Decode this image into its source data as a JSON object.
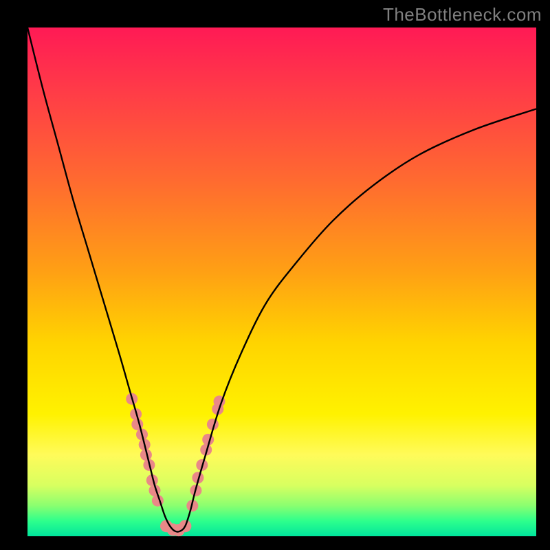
{
  "watermark": {
    "text": "TheBottleneck.com"
  },
  "chart_data": {
    "type": "line",
    "title": "",
    "xlabel": "",
    "ylabel": "",
    "xlim": [
      0,
      100
    ],
    "ylim": [
      0,
      100
    ],
    "grid": false,
    "legend": false,
    "series": [
      {
        "name": "bottleneck-curve",
        "x": [
          0,
          3,
          6,
          9,
          12,
          15,
          18,
          20,
          22,
          24,
          25,
          26,
          27,
          28,
          29,
          30,
          31,
          32,
          33,
          35,
          38,
          42,
          47,
          53,
          60,
          68,
          77,
          88,
          100
        ],
        "y": [
          100,
          88,
          77,
          66,
          56,
          46,
          36,
          29,
          22,
          14,
          10,
          7,
          4,
          2,
          1,
          1,
          2,
          5,
          9,
          16,
          26,
          36,
          46,
          54,
          62,
          69,
          75,
          80,
          84
        ]
      }
    ],
    "markers": [
      {
        "group": "left-branch",
        "points": [
          {
            "x": 20.5,
            "y": 27
          },
          {
            "x": 21.3,
            "y": 24
          },
          {
            "x": 21.6,
            "y": 22
          },
          {
            "x": 22.5,
            "y": 20
          },
          {
            "x": 23.0,
            "y": 18
          },
          {
            "x": 23.3,
            "y": 16
          },
          {
            "x": 23.9,
            "y": 14
          },
          {
            "x": 24.5,
            "y": 11
          },
          {
            "x": 25.0,
            "y": 9
          },
          {
            "x": 25.6,
            "y": 7
          }
        ]
      },
      {
        "group": "bottom",
        "points": [
          {
            "x": 27.3,
            "y": 2
          },
          {
            "x": 28.6,
            "y": 1.3
          },
          {
            "x": 29.7,
            "y": 1.2
          },
          {
            "x": 31.0,
            "y": 2
          }
        ]
      },
      {
        "group": "right-branch",
        "points": [
          {
            "x": 32.4,
            "y": 6
          },
          {
            "x": 33.1,
            "y": 9
          },
          {
            "x": 33.5,
            "y": 11.5
          },
          {
            "x": 34.3,
            "y": 14
          },
          {
            "x": 35.1,
            "y": 17
          },
          {
            "x": 35.5,
            "y": 19
          },
          {
            "x": 36.4,
            "y": 22
          },
          {
            "x": 37.4,
            "y": 25
          },
          {
            "x": 37.7,
            "y": 26.5
          }
        ]
      }
    ],
    "colors": {
      "curve": "#000000",
      "marker": "#e98888"
    }
  }
}
